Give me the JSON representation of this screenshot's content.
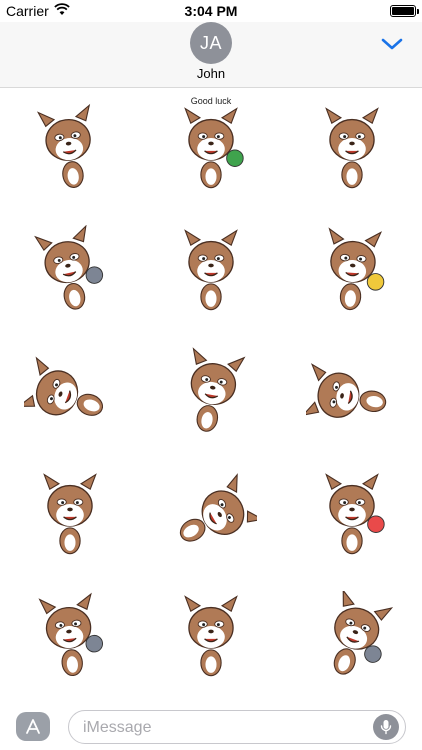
{
  "status_bar": {
    "carrier": "Carrier",
    "time": "3:04 PM",
    "battery_level": 1.0
  },
  "header": {
    "avatar_initials": "JA",
    "contact_name": "John"
  },
  "stickers": [
    {
      "name": "dog-cat-mask",
      "accent": "#b07a56"
    },
    {
      "name": "dog-good-luck",
      "accent": "#3fa34d",
      "caption": "Good luck"
    },
    {
      "name": "dog-standing-grumpy",
      "accent": "#b07a56"
    },
    {
      "name": "dog-with-cat-hug",
      "accent": "#7d8594"
    },
    {
      "name": "dog-covering-eyes",
      "accent": "#b07a56"
    },
    {
      "name": "dog-blonde-wig",
      "accent": "#f0c93b"
    },
    {
      "name": "dog-laughing-lying",
      "accent": "#b07a56"
    },
    {
      "name": "dog-dancing",
      "accent": "#b07a56"
    },
    {
      "name": "dog-sleeping",
      "accent": "#b07a56"
    },
    {
      "name": "dog-thumbs-up",
      "accent": "#b07a56"
    },
    {
      "name": "dog-rolling-laugh",
      "accent": "#b07a56"
    },
    {
      "name": "dog-birthday-cake",
      "accent": "#e94a4a"
    },
    {
      "name": "dog-with-cat-smug",
      "accent": "#7d8594"
    },
    {
      "name": "dog-shouting",
      "accent": "#b07a56"
    },
    {
      "name": "dog-and-cat-playing",
      "accent": "#7d8594"
    }
  ],
  "input_bar": {
    "placeholder": "iMessage"
  },
  "colors": {
    "accent_blue": "#1a73e8",
    "dog_brown": "#b07a56",
    "avatar_gray": "#8e9199"
  }
}
